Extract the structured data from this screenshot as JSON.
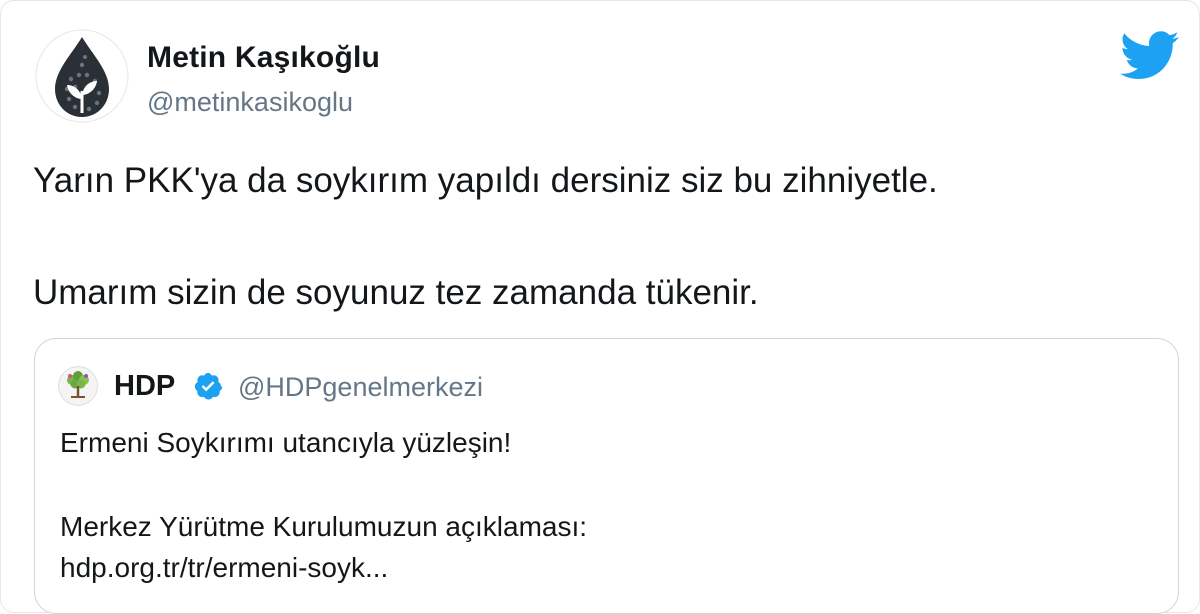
{
  "tweet": {
    "display_name": "Metin Kaşıkoğlu",
    "handle": "@metinkasikoglu",
    "avatar_icon": "water-drop-plant-icon",
    "platform_icon": "twitter-bird-icon",
    "brand_color": "#1da1f2",
    "text_lines": [
      "Yarın PKK'ya da soykırım yapıldı dersiniz siz bu zihniyetle.",
      "Umarım sizin de soyunuz tez zamanda tükenir."
    ]
  },
  "quoted_tweet": {
    "display_name": "HDP",
    "handle": "@HDPgenelmerkezi",
    "avatar_icon": "hdp-tree-logo-icon",
    "verified_icon": "verified-badge-icon",
    "text_lines": [
      "Ermeni Soykırımı utancıyla yüzleşin!",
      "Merkez Yürütme Kurulumuzun açıklaması:",
      "hdp.org.tr/tr/ermeni-soyk..."
    ]
  }
}
